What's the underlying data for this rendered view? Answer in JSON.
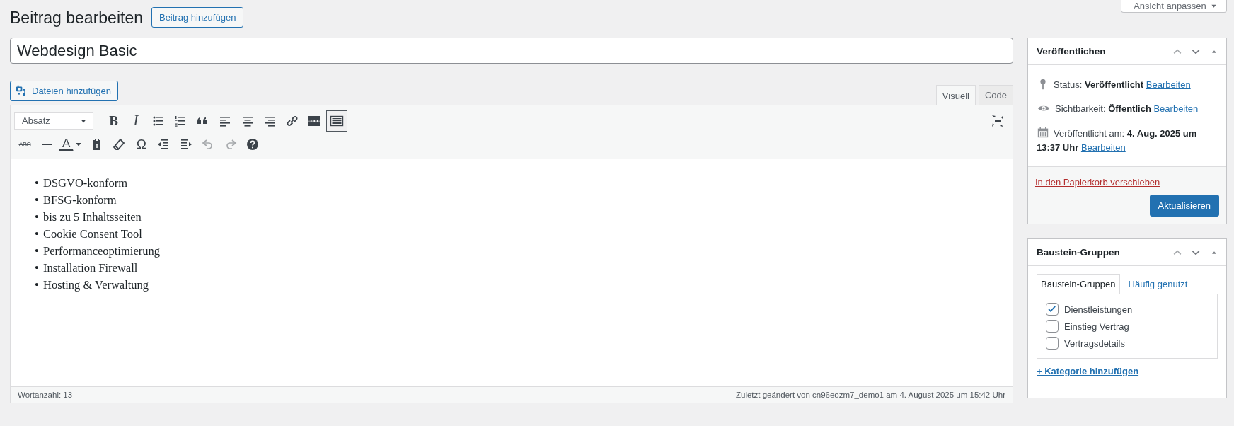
{
  "page": {
    "title": "Beitrag bearbeiten",
    "add_button": "Beitrag hinzufügen",
    "screen_options": "Ansicht anpassen"
  },
  "post_title": {
    "value": "Webdesign Basic"
  },
  "editor": {
    "media_button": "Dateien hinzufügen",
    "tabs": [
      {
        "label": "Visuell",
        "selected": true
      },
      {
        "label": "Code",
        "selected": false
      }
    ],
    "toolbar": {
      "format": "Absatz",
      "bold": "B",
      "italic": "I",
      "strikethrough": "ABC",
      "text_color": "A",
      "special_character": "Ω",
      "toggle_pressed": true,
      "undo_disabled": true,
      "redo_disabled": true
    },
    "content": [
      {
        "marker": "•",
        "text": "DSGVO-konform"
      },
      {
        "marker": "•",
        "text": "BFSG-konform"
      },
      {
        "marker": "•",
        "text": "bis zu 5 Inhaltsseiten"
      },
      {
        "marker": "•",
        "text": "Cookie Consent Tool"
      },
      {
        "marker": "•",
        "text": "Performanceoptimierung"
      },
      {
        "marker": "•",
        "text": "Installation Firewall"
      },
      {
        "marker": "•",
        "text": "Hosting & Verwaltung"
      }
    ],
    "word_count": "Wortanzahl: 13",
    "last_edited": "Zuletzt geändert von cn96eozm7_demo1 am 4. August 2025 um 15:42 Uhr"
  },
  "publish_box": {
    "title": "Veröffentlichen",
    "rows": [
      {
        "kind": "status",
        "text": "Status: **Veröffentlicht**",
        "link": "Bearbeiten"
      },
      {
        "kind": "visibility",
        "text": "Sichtbarkeit: **Öffentlich**",
        "link": "Bearbeiten"
      },
      {
        "kind": "date",
        "text": "Veröffentlicht am: **4. Aug. 2025 um 13:37 Uhr**",
        "link": "Bearbeiten"
      }
    ],
    "trash_link": "In den Papierkorb verschieben",
    "update_button": "Aktualisieren"
  },
  "groups_box": {
    "title": "Baustein-Gruppen",
    "tabs": [
      {
        "label": "Baustein-Gruppen",
        "selected": true
      },
      {
        "label": "Häufig genutzt",
        "selected": false
      }
    ],
    "categories": [
      {
        "label": "Dienstleistungen",
        "checked": true
      },
      {
        "label": "Einstieg Vertrag",
        "checked": false
      },
      {
        "label": "Vertragsdetails",
        "checked": false
      }
    ],
    "add_link": "+ Kategorie hinzufügen"
  }
}
